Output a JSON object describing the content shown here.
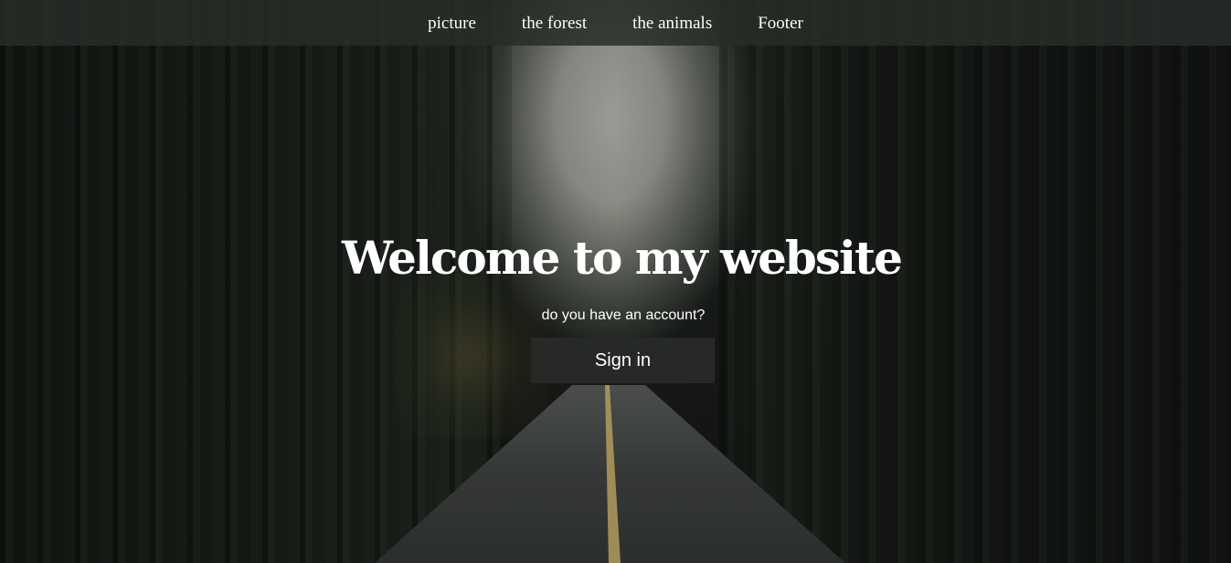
{
  "nav": {
    "items": [
      {
        "label": "picture"
      },
      {
        "label": "the forest"
      },
      {
        "label": "the animals"
      },
      {
        "label": "Footer"
      }
    ]
  },
  "hero": {
    "title": "Welcome to my website",
    "subtitle": "do you have an account?",
    "signin_label": "Sign in",
    "background": "forest-road-photo"
  },
  "colors": {
    "navbar_bg": "#2d312d",
    "button_bg": "#262926",
    "text": "#ffffff"
  }
}
